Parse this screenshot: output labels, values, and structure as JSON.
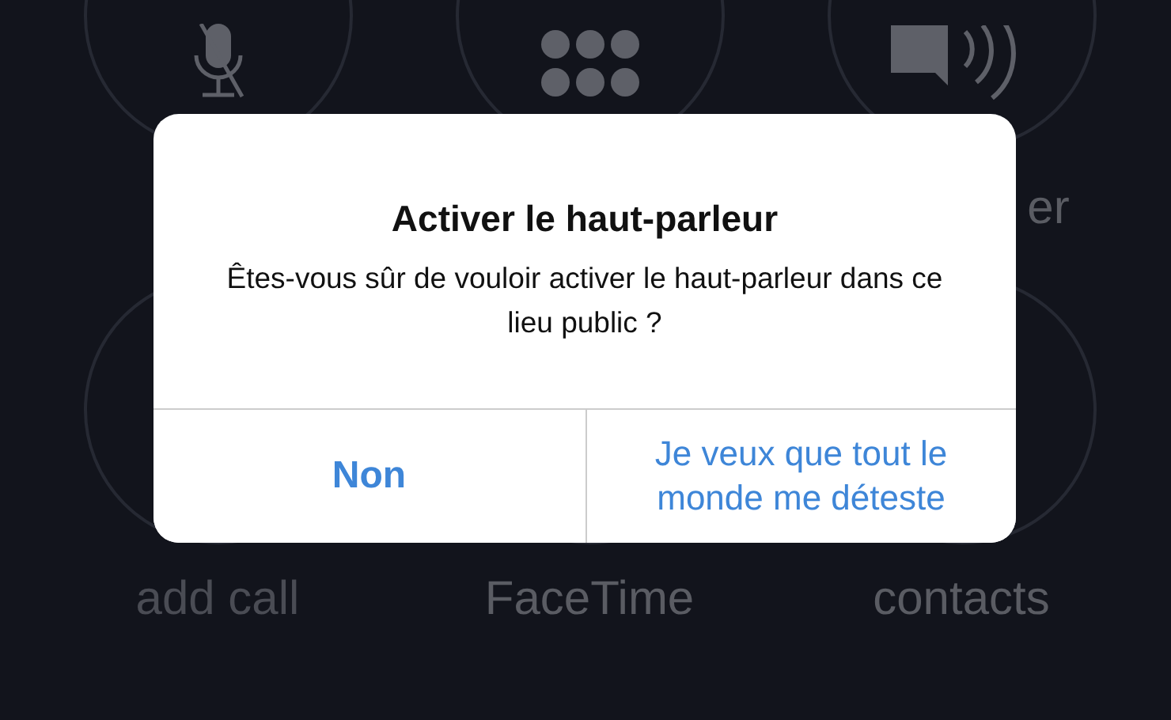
{
  "call_buttons": [
    {
      "kind": "mute"
    },
    {
      "kind": "keypad"
    },
    {
      "kind": "speaker",
      "label": "er"
    },
    {
      "kind": "plain",
      "label": "add call"
    },
    {
      "kind": "plain",
      "label": "FaceTime"
    },
    {
      "kind": "plain",
      "label": "contacts"
    }
  ],
  "alert": {
    "title": "Activer le haut-parleur",
    "message": "Êtes-vous sûr de vouloir activer le haut-parleur dans ce lieu public ?",
    "buttons": [
      {
        "label": "Non",
        "bold": true
      },
      {
        "label": "Je veux que tout le monde me déteste",
        "bold": false
      }
    ]
  }
}
